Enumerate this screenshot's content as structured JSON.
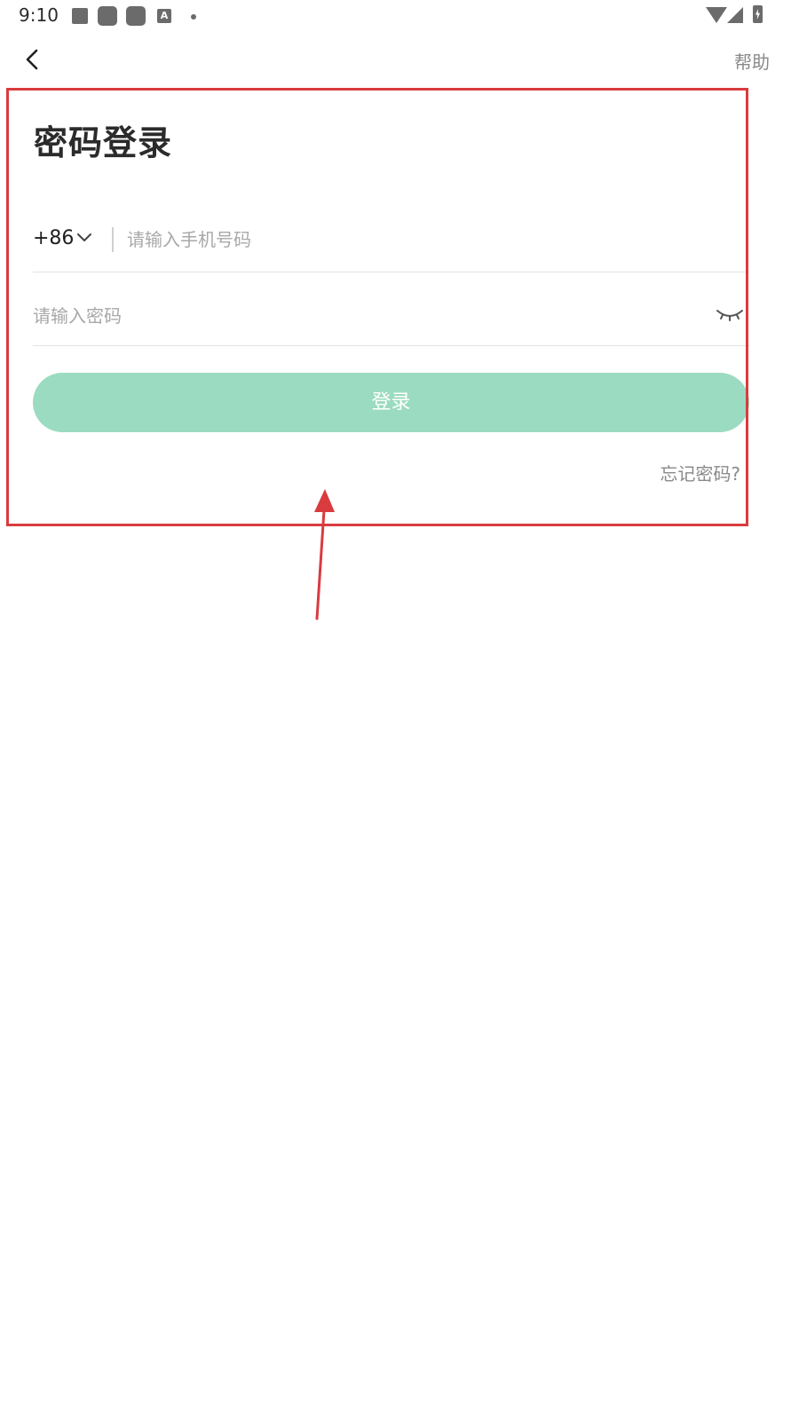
{
  "status_bar": {
    "time": "9:10",
    "font_badge": "A"
  },
  "top_bar": {
    "back_icon": "chevron-left-icon",
    "help_label": "帮助"
  },
  "login_form": {
    "title": "密码登录",
    "country_code": "+86",
    "phone_placeholder": "请输入手机号码",
    "phone_value": "",
    "password_placeholder": "请输入密码",
    "password_value": "",
    "password_toggle_icon": "eye-closed-icon",
    "login_label": "登录",
    "forgot_label": "忘记密码?"
  },
  "colors": {
    "accent_disabled": "#9bdbc1",
    "annotation": "#d93b3f",
    "muted_text": "#8a8a8a",
    "placeholder": "#a8a8a8"
  }
}
